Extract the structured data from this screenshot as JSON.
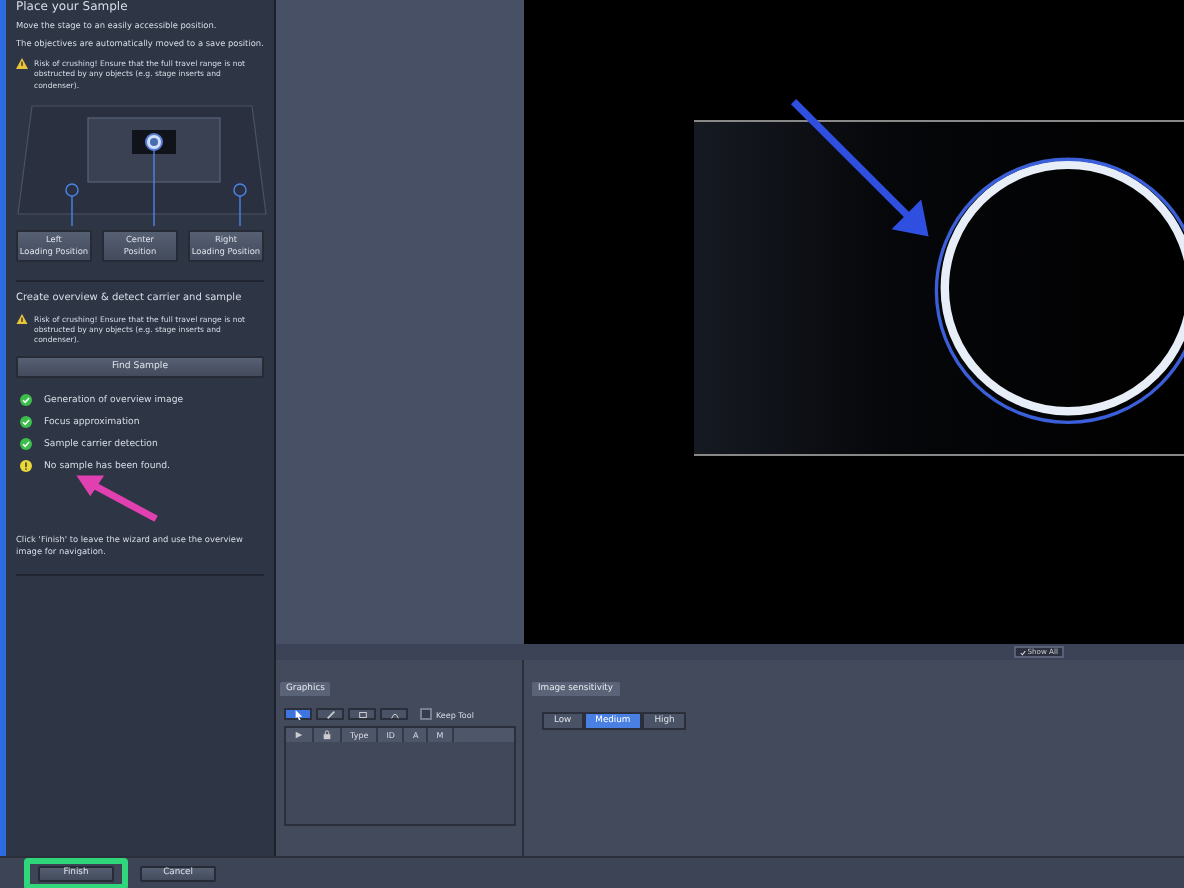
{
  "sample_panel": {
    "title": "Place your Sample",
    "instructions": [
      "Move the stage to an easily accessible position.",
      "The objectives are automatically moved to a save position."
    ],
    "warning": "Risk of crushing! Ensure that the full travel range is not obstructed by any objects (e.g. stage inserts and condenser).",
    "position_buttons": [
      "Left\nLoading Position",
      "Center\nPosition",
      "Right\nLoading Position"
    ]
  },
  "detect_panel": {
    "title": "Create overview & detect carrier and sample",
    "warning": "Risk of crushing! Ensure that the full travel range is not obstructed by any objects (e.g. stage inserts and condenser).",
    "button": "Find Sample",
    "steps": [
      {
        "kind": "ok",
        "label": "Generation of overview image"
      },
      {
        "kind": "ok",
        "label": "Focus approximation"
      },
      {
        "kind": "ok",
        "label": "Sample carrier detection"
      },
      {
        "kind": "warning",
        "label": "No sample has been found."
      }
    ],
    "footer": "Click 'Finish' to leave the wizard and use the overview image for navigation."
  },
  "viewer": {
    "show_all": {
      "label": "Show All",
      "checked": true
    }
  },
  "graphics": {
    "tab": "Graphics",
    "keep_tool": {
      "label": "Keep Tool",
      "checked": false
    },
    "columns": [
      "Type",
      "ID",
      "A",
      "M"
    ]
  },
  "sensitivity": {
    "tab": "Image sensitivity",
    "options": [
      {
        "label": "Low",
        "selected": false
      },
      {
        "label": "Medium",
        "selected": true
      },
      {
        "label": "High",
        "selected": false
      }
    ]
  },
  "buttons": [
    {
      "label": "Finish",
      "highlighted": true
    },
    {
      "label": "Cancel",
      "highlighted": false
    }
  ]
}
